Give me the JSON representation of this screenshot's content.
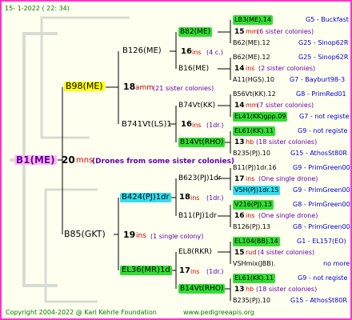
{
  "date": "15-   1-2022 ( 22: 34)",
  "footer": {
    "copyright": "Copyright 2004-2022 @ Karl Kehrle Foundation",
    "site": "www.pedigreeapis.org"
  },
  "root": {
    "name": "B1(ME)",
    "count": "20",
    "unit": "mns",
    "note": "(Drones from some sister colonies)"
  },
  "parents": [
    {
      "name": "B98(ME)",
      "count": "18",
      "unit": "amm",
      "note": "(21 sister colonies)"
    },
    {
      "name": "B85(GKT)",
      "count": "19",
      "unit": "ins",
      "note": "(1 single colony)"
    }
  ],
  "grandparents": [
    {
      "name": "B126(ME)",
      "count": "16",
      "unit": "ins",
      "note": "(4 c.)"
    },
    {
      "name": "B741Vt(LS)1",
      "count": "16",
      "unit": "ins",
      "note": "(1dr.)"
    },
    {
      "name": "B424(PJ)1dr",
      "count": "18",
      "unit": "ins",
      "note": "(1dr.)"
    },
    {
      "name": "EL36(MR)1d",
      "count": "17",
      "unit": "ins",
      "note": "(1dr.)"
    }
  ],
  "greatgrandparents": [
    {
      "name": "B82(ME)"
    },
    {
      "name": "B16(ME)"
    },
    {
      "name": "B74Vt(KK)"
    },
    {
      "name": "B14Vt(RHO)"
    },
    {
      "name": "B623(PJ)1dr"
    },
    {
      "name": "B11(PJ)1dr"
    },
    {
      "name": "EL8(RKR)"
    },
    {
      "name": "B14Vt(RHO)"
    }
  ],
  "gen4": [
    {
      "dam": "LB3(ME).14",
      "dam_info": "G5 - Buckfast",
      "count": "15",
      "unit": "mm",
      "note": "(6 sister colonies)",
      "sire": "B62(ME).12",
      "sire_info": "G25 - Sinop62R"
    },
    {
      "dam": "B62(ME).12",
      "dam_info": "G25 - Sinop62R",
      "count": "14",
      "unit": "ins",
      "note": "(2 sister colonies)",
      "sire": "A11(HGS).10",
      "sire_info": "G7 - Bayburt98-3"
    },
    {
      "dam": "B56Vt(KK).12",
      "dam_info": "G8 - PrimRed01",
      "count": "14",
      "unit": "mm",
      "note": "(7 sister colonies)",
      "sire": "EL41(KK)gpp.09",
      "sire_info": "G7 - not registe"
    },
    {
      "dam": "EL61(KK).11",
      "dam_info": "G9 - not registe",
      "count": "13",
      "unit": "hb",
      "note": "(18 sister colonies)",
      "sire": "B235(PJ).10",
      "sire_info": "G15 - AthosSt80R"
    },
    {
      "dam": "B11(PJ)1dr.16",
      "dam_info": "G9 - PrimGreen00",
      "count": "17",
      "unit": "ins",
      "note": "(One single drone)",
      "sire": "V5H(PJ)1dr.15",
      "sire_info": "G9 - PrimGreen00"
    },
    {
      "dam": "V216(PJ).13",
      "dam_info": "G8 - PrimGreen00",
      "count": "16",
      "unit": "ins",
      "note": "(One single drone)",
      "sire": "B126(PJ).13",
      "sire_info": "G8 - PrimGreen00"
    },
    {
      "dam": "EL104(BB).14",
      "dam_info": "G1 - EL157(EO)",
      "count": "15",
      "unit": "rud",
      "note": "(4 sister colonies)",
      "sire": "VSHmix(JBB).",
      "sire_info": "no more"
    },
    {
      "dam": "EL61(KK).11",
      "dam_info": "G9 - not registe",
      "count": "13",
      "unit": "hb",
      "note": "(18 sister colonies)",
      "sire": "B235(PJ).10",
      "sire_info": "G15 - AthosSt80R"
    }
  ]
}
